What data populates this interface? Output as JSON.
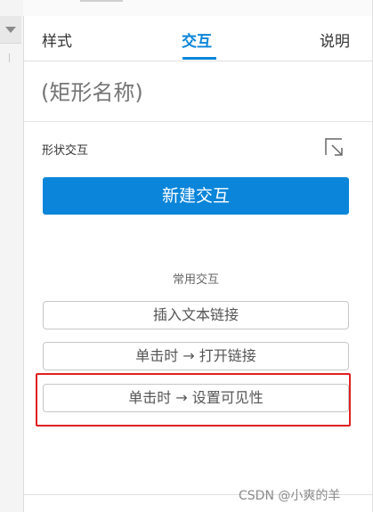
{
  "tabs": [
    {
      "label": "样式"
    },
    {
      "label": "交互"
    },
    {
      "label": "说明"
    }
  ],
  "name_field": {
    "placeholder": "(矩形名称)"
  },
  "shape_interaction": {
    "label": "形状交互",
    "expand_icon": "expand-arrow-icon"
  },
  "new_interaction_button": {
    "label": "新建交互"
  },
  "common_interactions": {
    "label": "常用交互",
    "items": [
      {
        "label": "插入文本链接"
      },
      {
        "label": "单击时 → 打开链接"
      },
      {
        "label": "单击时 → 设置可见性"
      }
    ]
  },
  "watermark": "CSDN @小爽的羊",
  "colors": {
    "accent": "#0a85d9",
    "highlight": "#e02020"
  }
}
